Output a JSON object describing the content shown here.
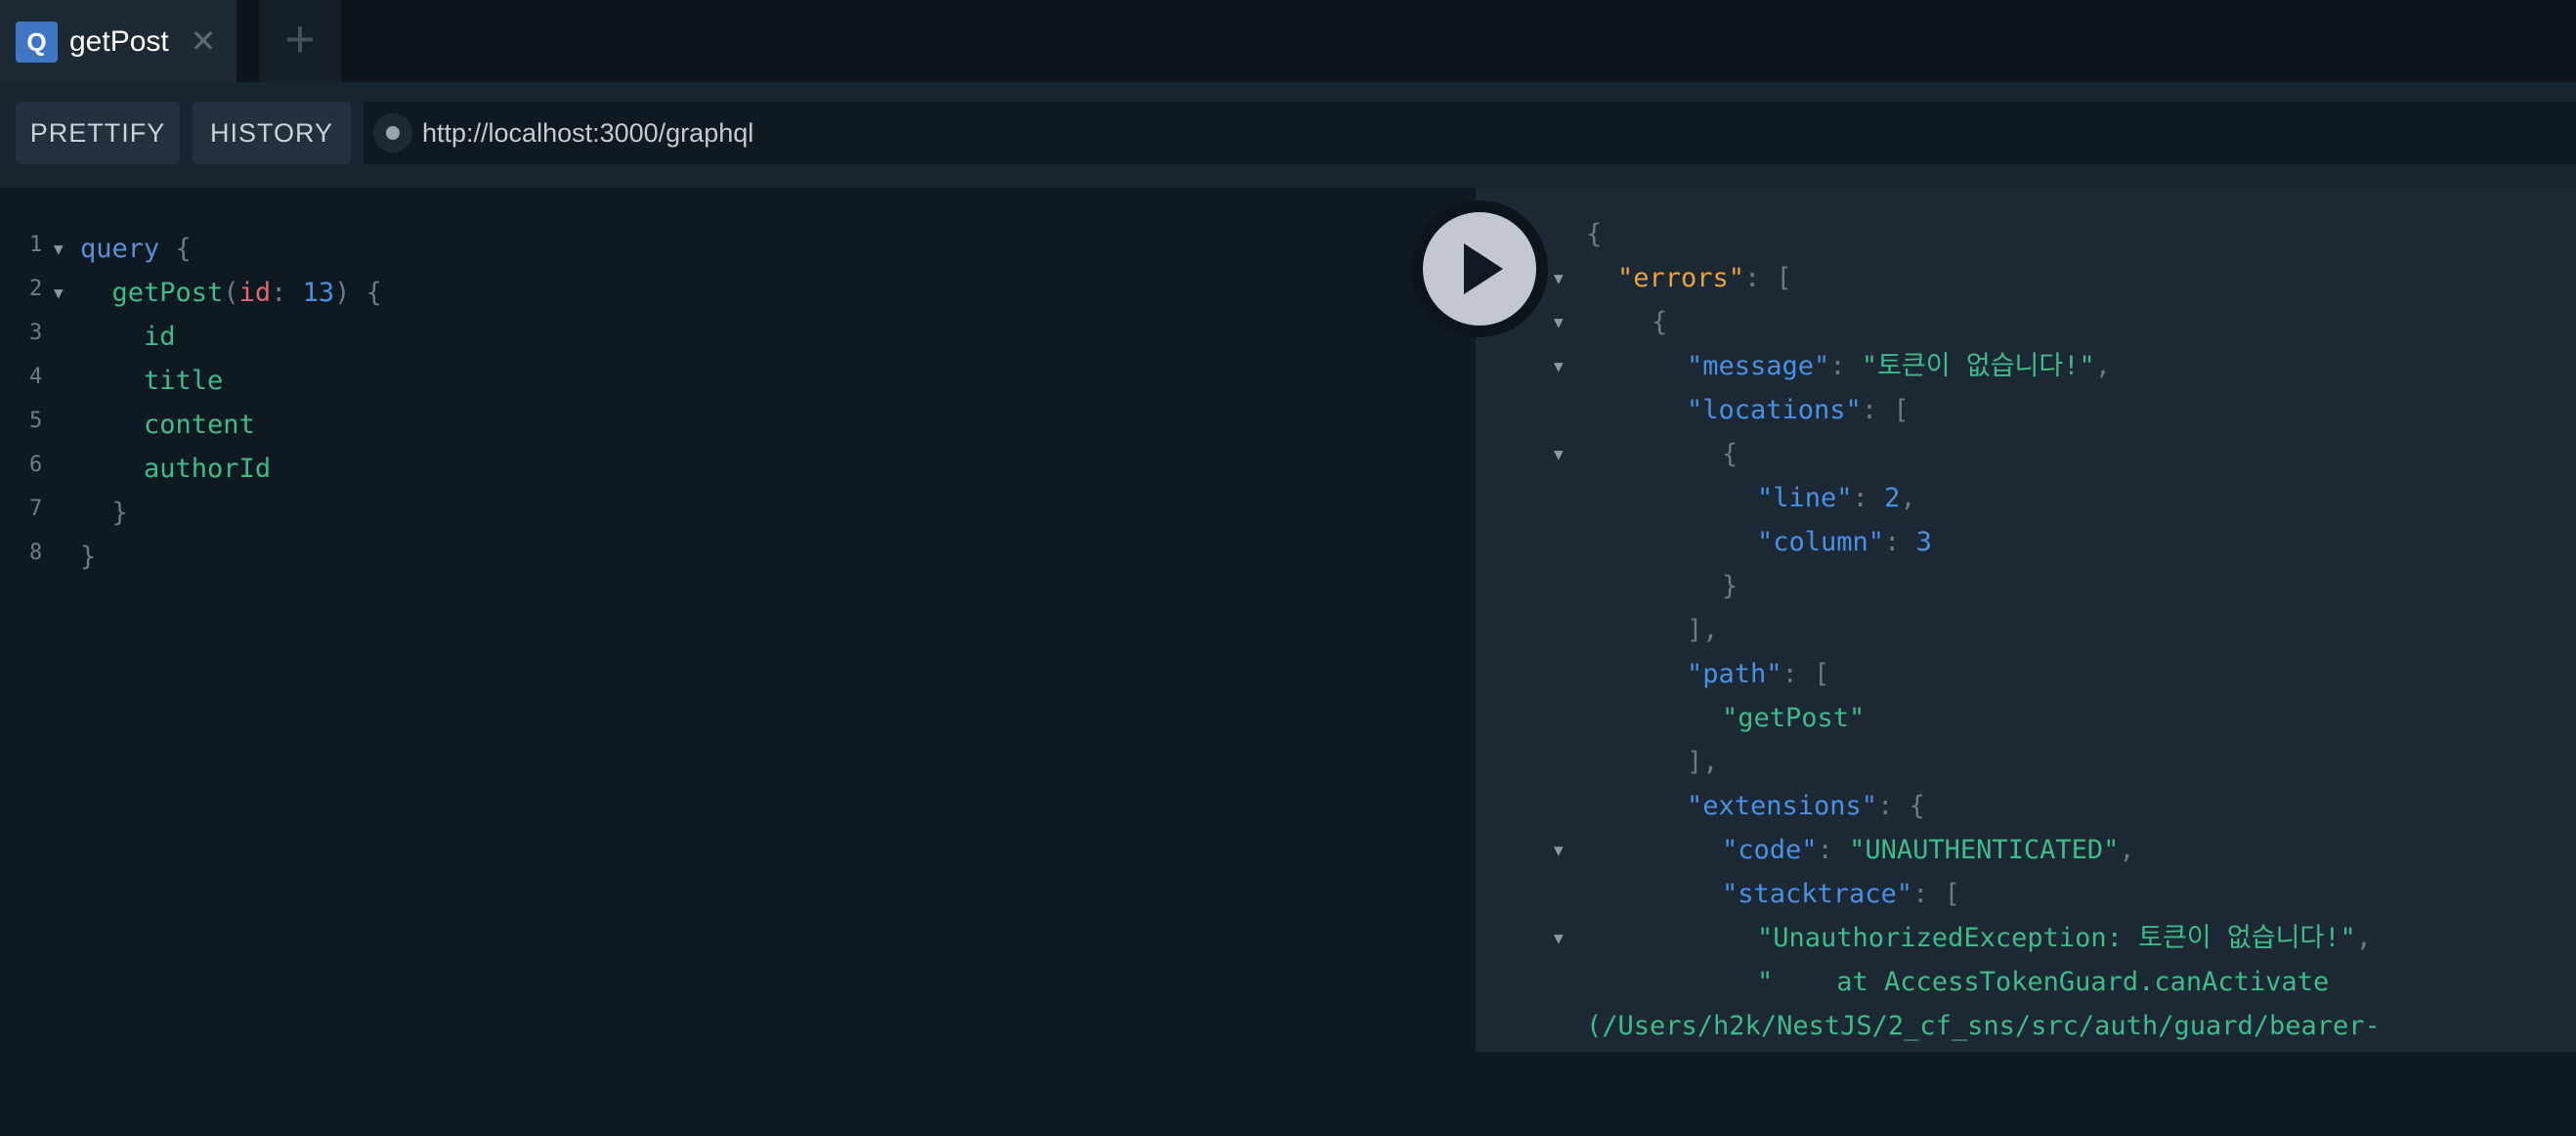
{
  "tabs": [
    {
      "badge": "Q",
      "title": "getPost",
      "close_glyph": "✕"
    }
  ],
  "add_tab_glyph": "+",
  "toolbar": {
    "prettify_label": "PRETTIFY",
    "history_label": "HISTORY",
    "endpoint_url": "http://localhost:3000/graphql"
  },
  "query_editor": {
    "lines": [
      {
        "number": "1",
        "fold": true
      },
      {
        "number": "2",
        "fold": true
      },
      {
        "number": "3",
        "fold": false
      },
      {
        "number": "4",
        "fold": false
      },
      {
        "number": "5",
        "fold": false
      },
      {
        "number": "6",
        "fold": false
      },
      {
        "number": "7",
        "fold": false
      },
      {
        "number": "8",
        "fold": false
      }
    ],
    "tokens": {
      "query_kw": "query",
      "open_brace": "{",
      "close_brace": "}",
      "operation": "getPost",
      "open_paren": "(",
      "close_paren": ")",
      "arg_name": "id",
      "colon": ":",
      "arg_value": "13",
      "fields": [
        "id",
        "title",
        "content",
        "authorId"
      ]
    }
  },
  "result": {
    "errors_key": "\"errors\"",
    "message_key": "\"message\"",
    "message_value": "\"토큰이 없습니다!\"",
    "locations_key": "\"locations\"",
    "line_key": "\"line\"",
    "line_value": "2",
    "column_key": "\"column\"",
    "column_value": "3",
    "path_key": "\"path\"",
    "path_value": "\"getPost\"",
    "extensions_key": "\"extensions\"",
    "code_key": "\"code\"",
    "code_value": "\"UNAUTHENTICATED\"",
    "stacktrace_key": "\"stacktrace\"",
    "stack_line_1": "\"UnauthorizedException: 토큰이 없습니다!\"",
    "stack_line_2": "\"    at AccessTokenGuard.canActivate",
    "stack_line_3": "(/Users/h2k/NestJS/2_cf_sns/src/auth/guard/bearer-"
  },
  "colors": {
    "accent": "#3f77c4",
    "keyword": "#5b8fd6",
    "field": "#3fba88",
    "argument": "#e0676f",
    "number": "#4a90e2",
    "error_key": "#e8a040"
  }
}
